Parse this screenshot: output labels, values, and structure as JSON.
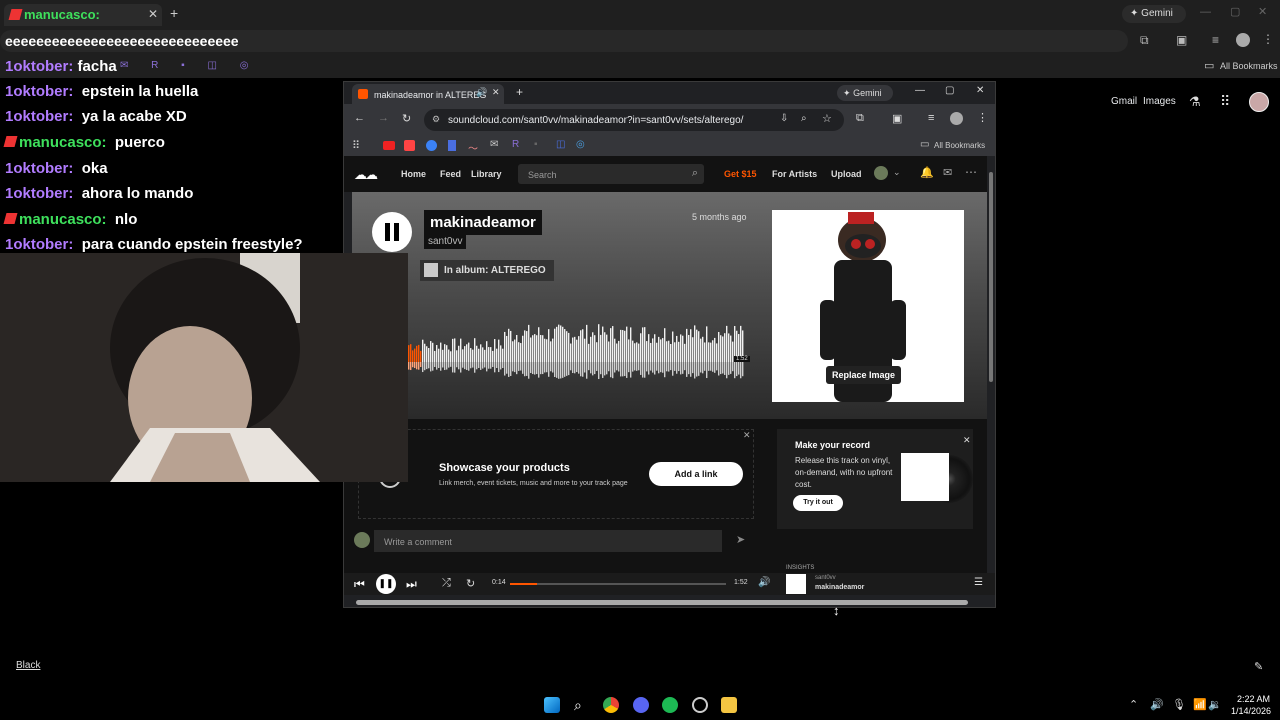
{
  "bg_browser": {
    "tab_title": "manucasco:",
    "gemini_label": "Gemini",
    "address_text": "eeeeeeeeeeeeeeeeeeeeeeeeeeeeee",
    "bookmark_text": "facha",
    "all_bookmarks": "All Bookmarks",
    "google_links": [
      "Gmail",
      "Images"
    ],
    "bottom_link": "Black"
  },
  "chat": [
    {
      "user": "1oktober:",
      "msg": "facha",
      "badge": false,
      "color": "purple"
    },
    {
      "user": "1oktober:",
      "msg": "epstein la huella",
      "badge": false,
      "color": "purple"
    },
    {
      "user": "1oktober:",
      "msg": "ya la acabe XD",
      "badge": false,
      "color": "purple"
    },
    {
      "user": "manucasco:",
      "msg": "puerco",
      "badge": true,
      "color": "green"
    },
    {
      "user": "1oktober:",
      "msg": "oka",
      "badge": false,
      "color": "purple"
    },
    {
      "user": "1oktober:",
      "msg": "ahora lo mando",
      "badge": false,
      "color": "purple"
    },
    {
      "user": "manucasco:",
      "msg": "nlo",
      "badge": true,
      "color": "green"
    },
    {
      "user": "1oktober:",
      "msg": "para cuando epstein freestyle?",
      "badge": false,
      "color": "purple"
    }
  ],
  "win": {
    "tab_title": "makinadeamor in ALTEREG",
    "gemini_label": "Gemini",
    "url": "soundcloud.com/sant0vv/makinadeamor?in=sant0vv/sets/alterego/",
    "all_bookmarks": "All Bookmarks"
  },
  "sc": {
    "nav": {
      "home": "Home",
      "feed": "Feed",
      "library": "Library",
      "search_placeholder": "Search",
      "get15": "Get $15",
      "for_artists": "For Artists",
      "upload": "Upload"
    },
    "track": {
      "title": "makinadeamor",
      "artist": "sant0vv",
      "album": "In album: ALTEREGO",
      "time_ago": "5 months ago",
      "duration_tag": "1:52"
    },
    "replace_image": "Replace Image",
    "promo": {
      "title": "Showcase your products",
      "desc": "Link merch, event tickets, music and more to your track page",
      "button": "Add a link"
    },
    "vinyl": {
      "title": "Make your record",
      "desc": "Release this track on vinyl, on-demand, with no upfront cost.",
      "button": "Try it out"
    },
    "comment_placeholder": "Write a comment",
    "insights": "INSIGHTS"
  },
  "player": {
    "elapsed": "0:14",
    "duration": "1:52",
    "artist": "sant0vv",
    "title": "makinadeamor",
    "progress": 0.125
  },
  "taskbar": {
    "time": "2:22 AM",
    "date": "1/14/2026"
  },
  "colors": {
    "soundcloud_orange": "#ff5500",
    "chat_purple": "#b17cff",
    "chat_green": "#3ee05c"
  }
}
